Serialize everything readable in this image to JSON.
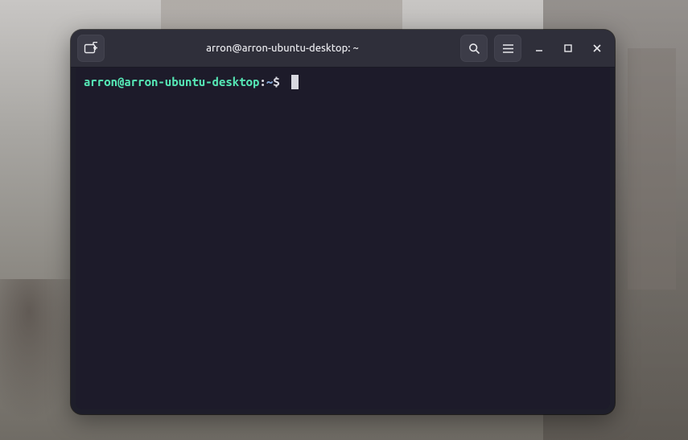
{
  "window": {
    "title": "arron@arron-ubuntu-desktop: ~"
  },
  "prompt": {
    "user_host": "arron@arron-ubuntu-desktop",
    "separator": ":",
    "path": "~",
    "symbol": "$ "
  },
  "colors": {
    "user_host": "#55e6b4",
    "path": "#84a8d6",
    "terminal_bg": "#1d1b2a",
    "titlebar_bg": "#2f2f3a"
  }
}
